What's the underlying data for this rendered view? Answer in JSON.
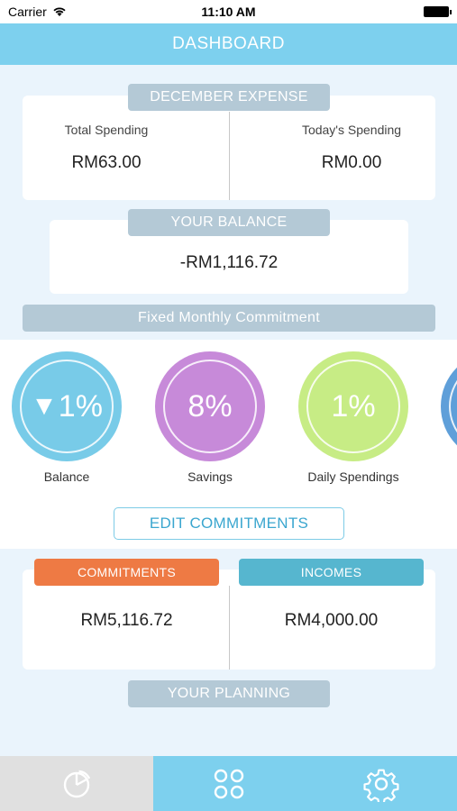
{
  "status_bar": {
    "carrier": "Carrier",
    "time": "11:10 AM"
  },
  "header": {
    "title": "DASHBOARD"
  },
  "expense": {
    "title": "DECEMBER EXPENSE",
    "total_label": "Total Spending",
    "total_value": "RM63.00",
    "today_label": "Today's Spending",
    "today_value": "RM0.00"
  },
  "balance": {
    "title": "YOUR BALANCE",
    "value": "-RM1,116.72"
  },
  "commitment": {
    "title": "Fixed Monthly Commitment",
    "items": [
      {
        "label": "Balance",
        "value": "1%",
        "color": "#78cbe8",
        "direction": "down"
      },
      {
        "label": "Savings",
        "value": "8%",
        "color": "#c78ad9"
      },
      {
        "label": "Daily Spendings",
        "value": "1%",
        "color": "#c7ec85"
      }
    ],
    "edit_label": "EDIT COMMITMENTS"
  },
  "summary": {
    "commitments_label": "COMMITMENTS",
    "commitments_value": "RM5,116.72",
    "commitments_color": "#ee7a44",
    "incomes_label": "INCOMES",
    "incomes_value": "RM4,000.00",
    "incomes_color": "#56b6cf"
  },
  "planning": {
    "title": "YOUR PLANNING"
  },
  "tabs": [
    {
      "icon": "pie-chart-icon"
    },
    {
      "icon": "grid-icon"
    },
    {
      "icon": "gear-icon"
    }
  ],
  "colors": {
    "header": "#7dd0ee",
    "pill": "#b4c9d6",
    "background": "#eaf4fc"
  }
}
